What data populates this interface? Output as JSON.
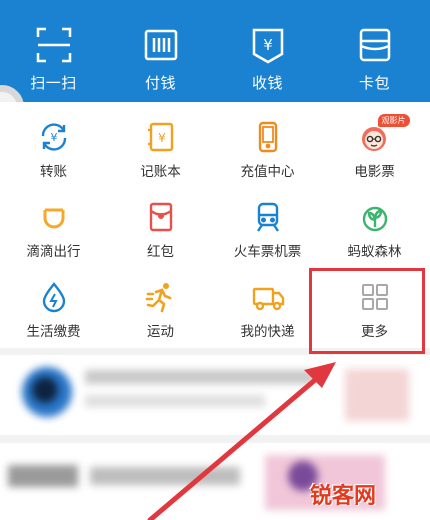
{
  "top_bar": {
    "color": "#1b82d2",
    "items": [
      {
        "label": "扫一扫",
        "icon": "scan-icon"
      },
      {
        "label": "付钱",
        "icon": "pay-barcode-icon"
      },
      {
        "label": "收钱",
        "icon": "receive-money-icon"
      },
      {
        "label": "卡包",
        "icon": "card-wallet-icon"
      }
    ]
  },
  "grid": {
    "items": [
      {
        "label": "转账",
        "icon": "transfer-icon"
      },
      {
        "label": "记账本",
        "icon": "account-book-icon"
      },
      {
        "label": "充值中心",
        "icon": "phone-recharge-icon"
      },
      {
        "label": "电影票",
        "icon": "movie-ticket-icon",
        "badge": "观影片"
      },
      {
        "label": "滴滴出行",
        "icon": "didi-icon"
      },
      {
        "label": "红包",
        "icon": "red-packet-icon"
      },
      {
        "label": "火车票机票",
        "icon": "train-ticket-icon"
      },
      {
        "label": "蚂蚁森林",
        "icon": "ant-forest-icon"
      },
      {
        "label": "生活缴费",
        "icon": "utility-payment-icon"
      },
      {
        "label": "运动",
        "icon": "sport-icon"
      },
      {
        "label": "我的快递",
        "icon": "express-delivery-icon"
      },
      {
        "label": "更多",
        "icon": "more-grid-icon"
      }
    ]
  },
  "annotation": {
    "highlight_color": "#e0383e"
  },
  "watermark": "锐客网"
}
